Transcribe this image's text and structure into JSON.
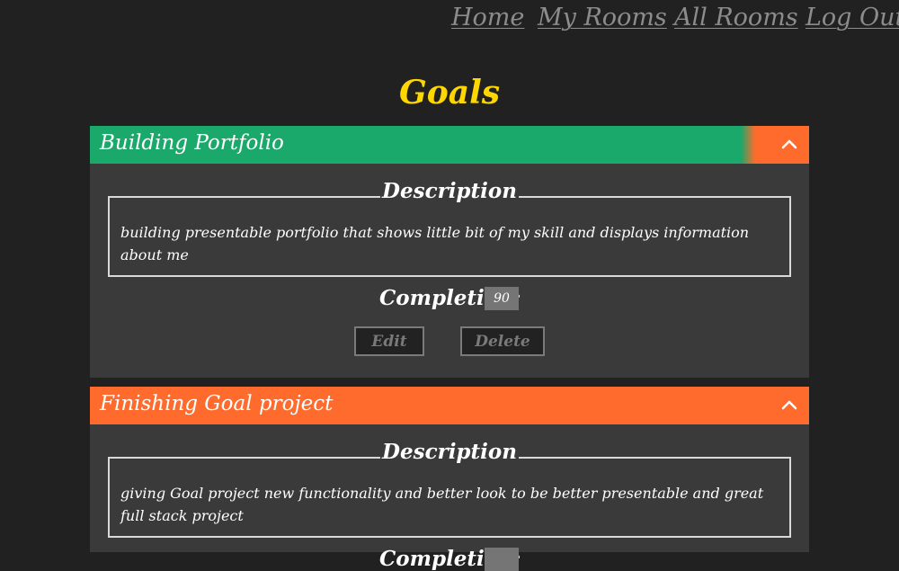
{
  "nav": {
    "home": "Home",
    "my_rooms": "My Rooms",
    "all_rooms": "All Rooms",
    "log_out": "Log Out"
  },
  "page_title": "Goals",
  "goals": [
    {
      "title": "Building Portfolio",
      "header_color": "#1aa86b",
      "accent_color": "#ff6b2c",
      "description_label": "Description",
      "description": "building presentable portfolio that shows little bit of my skill and displays information about me",
      "completion_label": "Completion:",
      "completion_value": "90",
      "edit_label": "Edit",
      "delete_label": "Delete"
    },
    {
      "title": "Finishing Goal project",
      "header_color": "#ff6b2c",
      "description_label": "Description",
      "description": "giving Goal project new functionality and better look to be better presentable and great full stack project",
      "completion_label": "Completion:",
      "completion_value": ""
    }
  ],
  "icons": {
    "collapse": "chevron-up-icon"
  }
}
